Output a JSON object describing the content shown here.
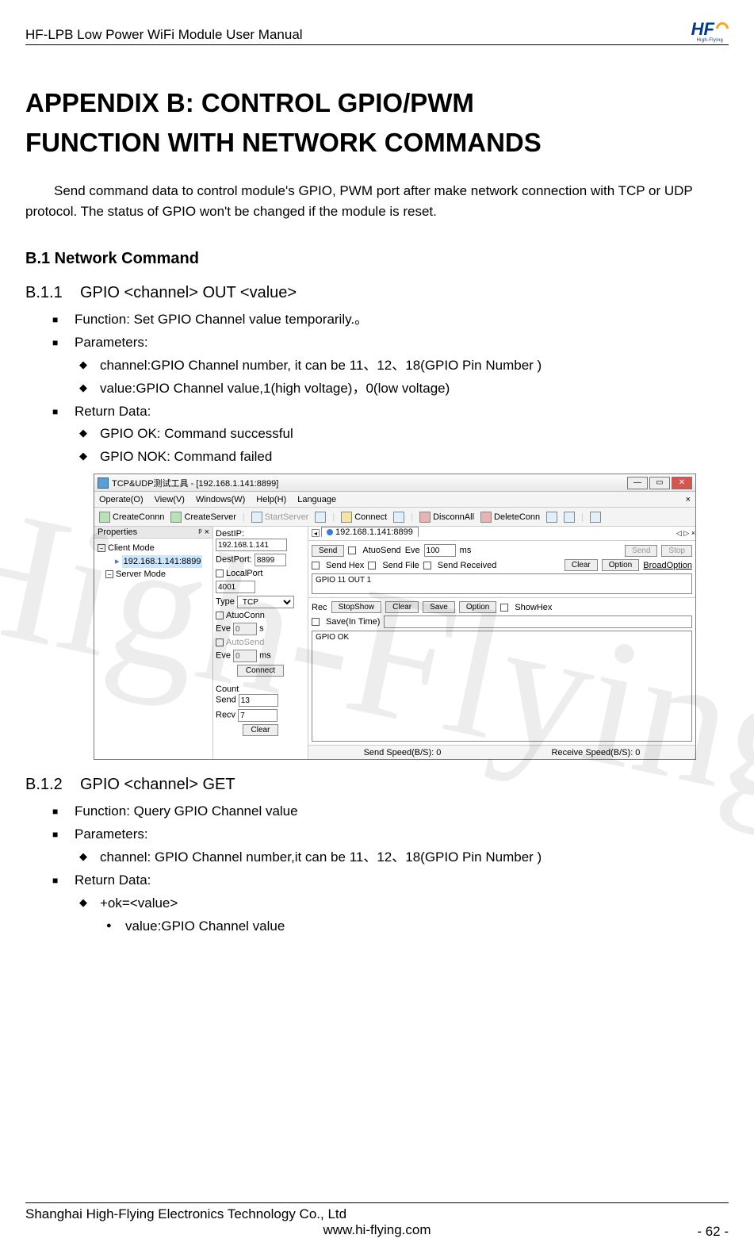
{
  "header": "HF-LPB Low Power WiFi Module User Manual",
  "logo_text": "HF",
  "logo_sub": "High-Flying",
  "h1_a": "APPENDIX B: CONTROL GPIO/PWM",
  "h1_b": "FUNCTION WITH NETWORK COMMANDS",
  "intro": "Send command data to control module's GPIO, PWM port after make network connection with TCP or UDP protocol. The status of GPIO won't be changed if the module is reset.",
  "sec_b1": "B.1 Network Command",
  "s1": {
    "num": "B.1.1",
    "title": "GPIO <channel> OUT <value>",
    "fn": "Function: Set GPIO Channel value temporarily.。",
    "params_label": "Parameters:",
    "p1": "channel:GPIO Channel number, it can be 11、12、18(GPIO Pin Number )",
    "p2": "value:GPIO Channel value,1(high voltage)，0(low voltage)",
    "ret_label": "Return Data:",
    "r1": "GPIO OK: Command successful",
    "r2": "GPIO NOK: Command failed"
  },
  "s2": {
    "num": "B.1.2",
    "title": "GPIO <channel> GET",
    "fn": "Function: Query GPIO Channel value",
    "params_label": "Parameters:",
    "p1": "channel: GPIO Channel number,it can be 11、12、18(GPIO Pin Number )",
    "ret_label": "Return Data:",
    "r1": "+ok=<value>",
    "r1_a": "value:GPIO Channel value"
  },
  "app": {
    "title": "TCP&UDP测试工具 - [192.168.1.141:8899]",
    "menu": {
      "operate": "Operate(O)",
      "view": "View(V)",
      "windows": "Windows(W)",
      "help": "Help(H)",
      "lang": "Language"
    },
    "tools": {
      "create_conn": "CreateConnn",
      "create_server": "CreateServer",
      "start_server": "StartServer",
      "connect": "Connect",
      "disconn_all": "DisconnAll",
      "delete_conn": "DeleteConn"
    },
    "props": "Properties",
    "props_pin": "ᵖ ×",
    "tree": {
      "client": "Client Mode",
      "client_ip": "192.168.1.141:8899",
      "server": "Server Mode"
    },
    "mid": {
      "destip_l": "DestIP:",
      "destip": "192.168.1.141",
      "destport_l": "DestPort:",
      "destport": "8899",
      "localport_l": "LocalPort",
      "localport": "4001",
      "type_l": "Type",
      "type": "TCP",
      "atuo": "AtuoConn",
      "eve1_l": "Eve",
      "eve1": "0",
      "eve1_u": "s",
      "autosend": "AutoSend",
      "eve2_l": "Eve",
      "eve2": "0",
      "eve2_u": "ms",
      "connect_btn": "Connect",
      "count": "Count",
      "send_l": "Send",
      "send": "13",
      "recv_l": "Recv",
      "recv": "7",
      "clear_btn": "Clear"
    },
    "tab_ip": "192.168.1.141:8899",
    "tab_nav": "◁ ▷ ×",
    "send_btn": "Send",
    "atuo2": "AtuoSend",
    "eve3_l": "Eve",
    "eve3": "100",
    "eve3_u": "ms",
    "send2": "Send",
    "stop": "Stop",
    "sendhex": "Send Hex",
    "sendfile": "Send File",
    "sendrecv": "Send Received",
    "clear2": "Clear",
    "option": "Option",
    "broad": "BroadOption",
    "send_box": "GPIO 11 OUT 1",
    "rec": "Rec",
    "stopshow": "StopShow",
    "clear3": "Clear",
    "save": "Save",
    "option2": "Option",
    "showhex": "ShowHex",
    "saveintime": "Save(In Time)",
    "recv_box": "GPIO OK",
    "status_send": "Send Speed(B/S): 0",
    "status_recv": "Receive Speed(B/S): 0"
  },
  "watermark": "High-Flying",
  "footer": {
    "company": "Shanghai High-Flying Electronics Technology Co., Ltd",
    "url": "www.hi-flying.com",
    "page": "- 62 -"
  }
}
